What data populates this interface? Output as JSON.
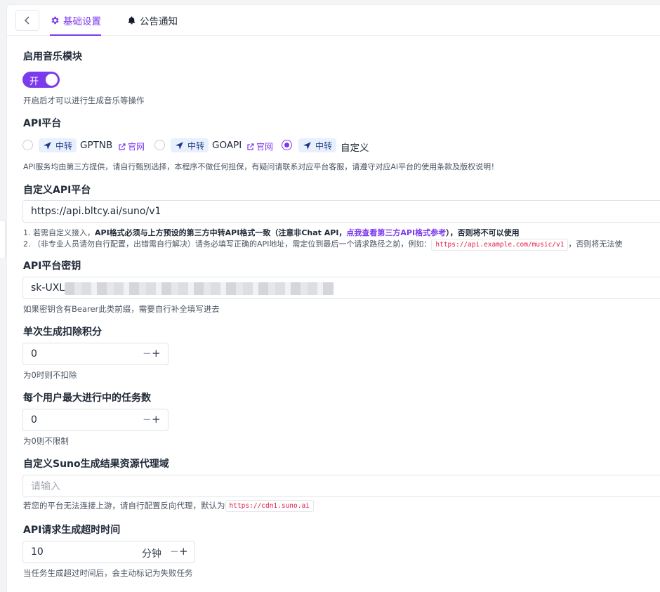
{
  "tabs": [
    {
      "label": "基础设置",
      "icon": "gear-icon",
      "active": true
    },
    {
      "label": "公告通知",
      "icon": "bell-icon",
      "active": false
    }
  ],
  "accent": "#7c3aed",
  "music_module": {
    "label": "启用音乐模块",
    "toggle_text": "开",
    "enabled": true,
    "help": "开启后才可以进行生成音乐等操作"
  },
  "api_platform": {
    "label": "API平台",
    "options": [
      {
        "badge": "中转",
        "name": "GPTNB",
        "link": "官网",
        "checked": false
      },
      {
        "badge": "中转",
        "name": "GOAPI",
        "link": "官网",
        "checked": false
      },
      {
        "badge": "中转",
        "name": "自定义",
        "checked": true
      }
    ],
    "help": "API服务均由第三方提供，请自行甄别选择，本程序不做任何担保，有疑问请联系对应平台客服，请遵守对应AI平台的使用条款及版权说明！"
  },
  "custom_api": {
    "label": "自定义API平台",
    "value": "https://api.bltcy.ai/suno/v1",
    "help1_a": "1. 若需自定义接入，",
    "help1_b": "API格式必须与上方预设的第三方中转API格式一致（注意非Chat API，",
    "help1_link": "点我查看第三方API格式参考",
    "help1_c": "），",
    "help1_d": "否则将不可以使用",
    "help2_a": "2. （非专业人员请勿自行配置，出错需自行解决）请务必填写正确的API地址，需定位到最后一个请求路径之前，例如：",
    "help2_code": "https://api.example.com/music/v1",
    "help2_b": "，否则将无法使"
  },
  "api_key": {
    "label": "API平台密钥",
    "value": "sk-UXL",
    "help": "如果密钥含有Bearer此类前缀，需要自行补全填写进去"
  },
  "deduct_points": {
    "label": "单次生成扣除积分",
    "value": "0",
    "help": "为0时则不扣除"
  },
  "max_tasks": {
    "label": "每个用户最大进行中的任务数",
    "value": "0",
    "help": "为0则不限制"
  },
  "proxy_domain": {
    "label": "自定义Suno生成结果资源代理域",
    "placeholder": "请输入",
    "help": "若您的平台无法连接上游，请自行配置反向代理，默认为",
    "help_code": "https://cdn1.suno.ai"
  },
  "timeout": {
    "label": "API请求生成超时时间",
    "value": "10",
    "suffix": "分钟",
    "help": "当任务生成超过时间后，会主动标记为失败任务"
  },
  "stepper": {
    "minus": "−",
    "plus": "+"
  }
}
